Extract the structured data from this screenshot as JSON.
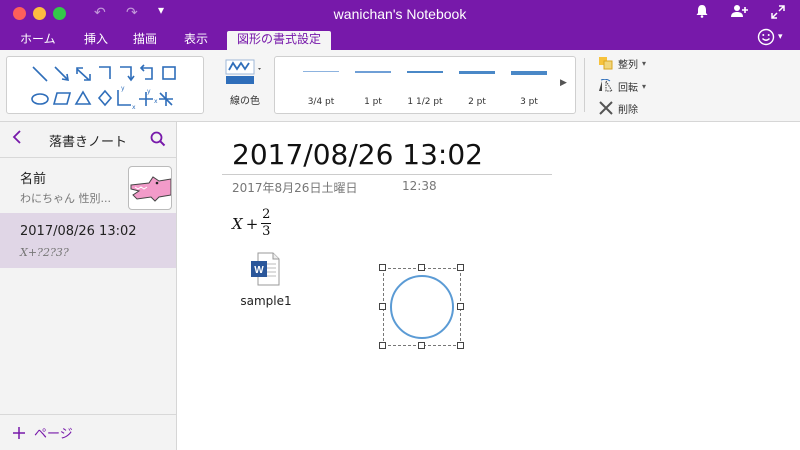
{
  "app": {
    "title": "wanichan's Notebook"
  },
  "tabs": [
    {
      "label": "ホーム"
    },
    {
      "label": "挿入"
    },
    {
      "label": "描画"
    },
    {
      "label": "表示"
    },
    {
      "label": "図形の書式設定",
      "active": true
    }
  ],
  "ribbon": {
    "shapes": [
      "line",
      "arrow",
      "double-arrow",
      "elbow",
      "elbow-arrow",
      "elbow-double-arrow",
      "rectangle",
      "ellipse",
      "parallelogram",
      "triangle",
      "diamond",
      "axis-2d",
      "axis-xy",
      "axis-3d"
    ],
    "pen_color_label": "線の色",
    "line_widths": [
      {
        "label": "3/4 pt"
      },
      {
        "label": "1 pt"
      },
      {
        "label": "1 1/2 pt"
      },
      {
        "label": "2 pt"
      },
      {
        "label": "3 pt"
      }
    ],
    "actions": {
      "arrange": "整列",
      "rotate": "回転",
      "delete": "削除"
    }
  },
  "sidebar": {
    "title": "落書きノート",
    "pages": [
      {
        "title": "名前",
        "preview": "わにちゃん 性別..."
      },
      {
        "title": "2017/08/26 13:02",
        "preview": "X+?2?3?",
        "selected": true
      }
    ],
    "add_page_label": "ページ"
  },
  "page": {
    "title": "2017/08/26 13:02",
    "date": "2017年8月26日土曜日",
    "time": "12:38",
    "math": {
      "variable": "X",
      "operator": "+",
      "numerator": "2",
      "denominator": "3"
    },
    "attachment": {
      "name": "sample1",
      "icon": "word-document-icon"
    }
  },
  "colors": {
    "accent": "#7719aa",
    "shape_stroke": "#5b9bd5",
    "ribbon_blue": "#2f6eba"
  }
}
